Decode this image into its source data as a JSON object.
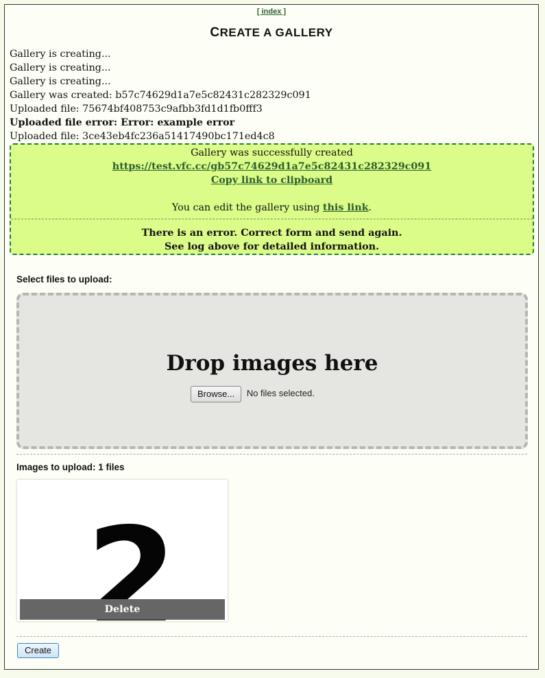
{
  "nav": {
    "index_link": "[ index ]"
  },
  "page": {
    "title_cap": "C",
    "title_rest": "REATE A GALLERY"
  },
  "log": [
    "Gallery is creating...",
    "Gallery is creating...",
    "Gallery is creating...",
    "Gallery was created: b57c74629d1a7e5c82431c282329c091",
    "Uploaded file: 75674bf408753c9afbb3fd1d1fb0fff3",
    "Uploaded file error: Error: example error",
    "Uploaded file: 3ce43eb4fc236a51417490bc171ed4c8"
  ],
  "result": {
    "success_text": "Gallery was successfully created",
    "gallery_url": "https://test.vfc.cc/gb57c74629d1a7e5c82431c282329c091",
    "copy_link": "Copy link to clipboard",
    "edit_prefix": "You can edit the gallery using ",
    "edit_link": "this link",
    "edit_suffix": ".",
    "error_line1": "There is an error. Correct form and send again.",
    "error_line2": "See log above for detailed information."
  },
  "upload": {
    "select_label": "Select files to upload:",
    "drop_title": "Drop images here",
    "browse_button": "Browse...",
    "file_status": "No files selected."
  },
  "queue": {
    "label": "Images to upload: 1 files",
    "thumb_digit": "2",
    "delete_label": "Delete"
  },
  "actions": {
    "create_button": "Create"
  },
  "colors": {
    "success_bg": "#dbfc88",
    "link": "#2c5e2e",
    "page_bg": "#fdfff6"
  }
}
